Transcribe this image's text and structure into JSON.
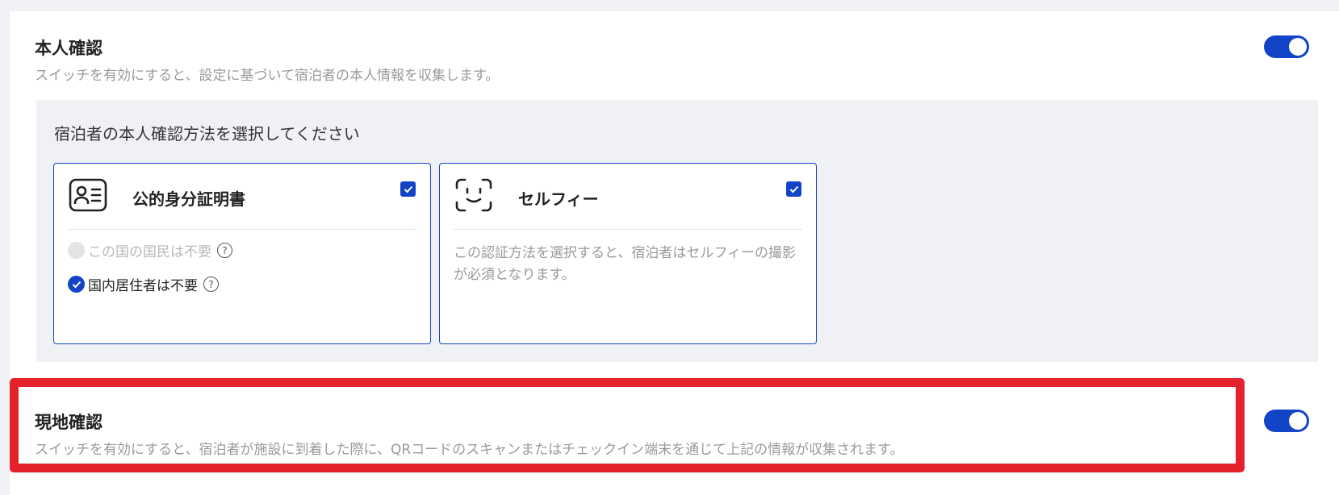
{
  "identity": {
    "title": "本人確認",
    "description": "スイッチを有効にすると、設定に基づいて宿泊者の本人情報を収集します。",
    "toggle_on": true
  },
  "methods": {
    "heading": "宿泊者の本人確認方法を選択してください",
    "id_card": {
      "icon": "id-card-icon",
      "title": "公的身分証明書",
      "checked": true,
      "options": [
        {
          "label": "この国の国民は不要",
          "checked": false,
          "disabled": true,
          "help": "?"
        },
        {
          "label": "国内居住者は不要",
          "checked": true,
          "disabled": false,
          "help": "?"
        }
      ]
    },
    "selfie": {
      "icon": "face-scan-icon",
      "title": "セルフィー",
      "checked": true,
      "description": "この認証方法を選択すると、宿泊者はセルフィーの撮影が必須となります。"
    }
  },
  "onsite": {
    "title": "現地確認",
    "description": "スイッチを有効にすると、宿泊者が施設に到着した際に、QRコードのスキャンまたはチェックイン端末を通じて上記の情報が収集されます。",
    "toggle_on": true
  },
  "colors": {
    "accent": "#1244c8",
    "highlight": "#e3222c",
    "background": "#f0f1f5"
  }
}
